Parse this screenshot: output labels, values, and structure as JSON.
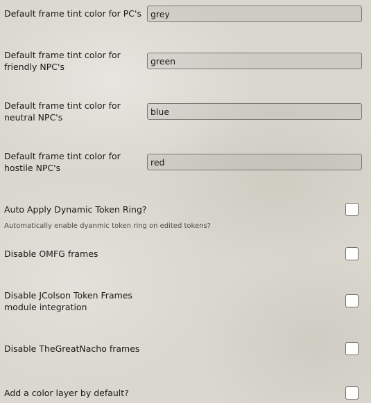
{
  "settings": {
    "pc_tint": {
      "label": "Default frame tint color for PC's",
      "value": "grey"
    },
    "friendly_tint": {
      "label": "Default frame tint color for friendly NPC's",
      "value": "green"
    },
    "neutral_tint": {
      "label": "Default frame tint color for neutral NPC's",
      "value": "blue"
    },
    "hostile_tint": {
      "label": "Default frame tint color for hostile NPC's",
      "value": "red"
    },
    "auto_ring": {
      "label": "Auto Apply Dynamic Token Ring?",
      "hint": "Automatically enable dyanmic token ring on edited tokens?",
      "checked": false
    },
    "disable_omfg": {
      "label": "Disable OMFG frames",
      "checked": false
    },
    "disable_jcolson": {
      "label": "Disable JColson Token Frames module integration",
      "checked": false
    },
    "disable_nacho": {
      "label": "Disable TheGreatNacho frames",
      "checked": false
    },
    "color_layer": {
      "label": "Add a color layer by default?",
      "checked": false
    }
  }
}
